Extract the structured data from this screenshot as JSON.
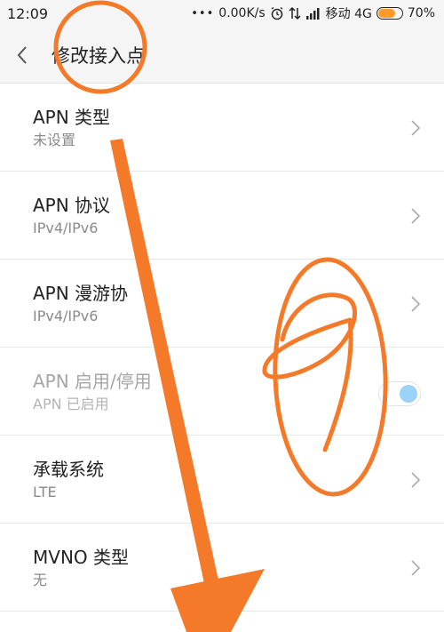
{
  "status_bar": {
    "time": "12:09",
    "dots": "•••",
    "speed": "0.00K/s",
    "carrier": "移动 4G",
    "battery": "70%",
    "battery_level": 0.7,
    "battery_color": "#ff9a22"
  },
  "title_bar": {
    "back_icon": "back-arrow-icon",
    "title": "修改接入点"
  },
  "settings": [
    {
      "title": "APN 类型",
      "subtitle": "未设置",
      "control": "chevron"
    },
    {
      "title": "APN 协议",
      "subtitle": "IPv4/IPv6",
      "control": "chevron"
    },
    {
      "title": "APN 漫游协",
      "subtitle": "IPv4/IPv6",
      "control": "chevron"
    },
    {
      "title": "APN 启用/停用",
      "subtitle": "APN 已启用",
      "control": "toggle",
      "enabled": true
    },
    {
      "title": "承载系统",
      "subtitle": "LTE",
      "control": "chevron"
    },
    {
      "title": "MVNO 类型",
      "subtitle": "无",
      "control": "chevron"
    }
  ],
  "annotations": {
    "color": "#f47a2a",
    "circle_text": "1"
  }
}
